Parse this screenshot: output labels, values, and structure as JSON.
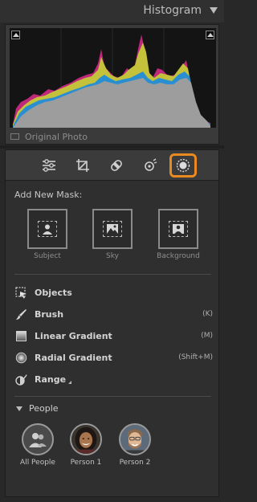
{
  "histogram": {
    "title": "Histogram",
    "original_photo_label": "Original Photo"
  },
  "masking": {
    "add_new_mask_label": "Add New Mask:",
    "mask_types": [
      {
        "label": "Subject",
        "icon": "subject-icon"
      },
      {
        "label": "Sky",
        "icon": "sky-icon"
      },
      {
        "label": "Background",
        "icon": "background-icon"
      }
    ],
    "tools": [
      {
        "label": "Objects",
        "shortcut": "",
        "icon": "objects-icon"
      },
      {
        "label": "Brush",
        "shortcut": "(K)",
        "icon": "brush-icon"
      },
      {
        "label": "Linear Gradient",
        "shortcut": "(M)",
        "icon": "linear-gradient-icon"
      },
      {
        "label": "Radial Gradient",
        "shortcut": "(Shift+M)",
        "icon": "radial-gradient-icon"
      },
      {
        "label": "Range",
        "shortcut": "",
        "icon": "range-icon"
      }
    ],
    "people_section_label": "People",
    "people": [
      {
        "label": "All People"
      },
      {
        "label": "Person 1"
      },
      {
        "label": "Person 2"
      }
    ]
  },
  "toolbar_icons": [
    "edit-sliders-icon",
    "crop-icon",
    "heal-icon",
    "red-eye-icon",
    "masking-icon"
  ],
  "colors": {
    "accent_active": "#e88a1f",
    "panel_bg": "#2f2f2f"
  }
}
